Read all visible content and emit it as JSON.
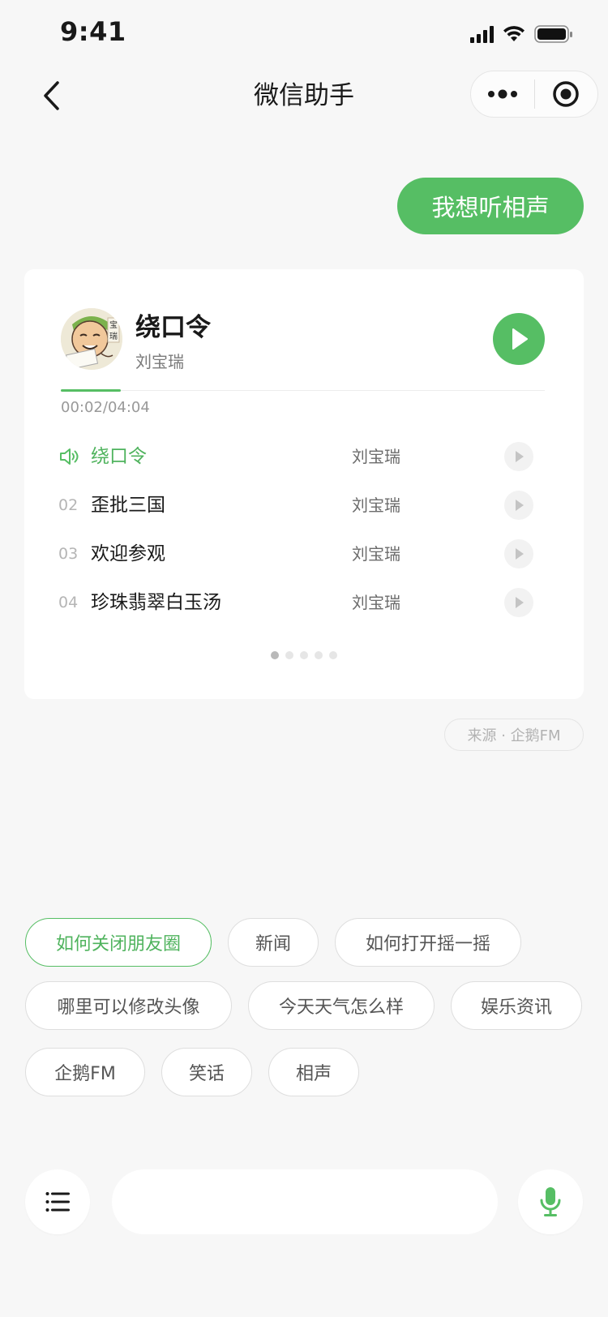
{
  "status_bar": {
    "time": "9:41"
  },
  "nav": {
    "title": "微信助手"
  },
  "chat": {
    "user_message": "我想听相声"
  },
  "player": {
    "current_title": "绕口令",
    "current_artist": "刘宝瑞",
    "time_display": "00:02/04:04",
    "progress_fraction": 0.008,
    "tracks": [
      {
        "number": "",
        "title": "绕口令",
        "artist": "刘宝瑞",
        "active": true
      },
      {
        "number": "02",
        "title": "歪批三国",
        "artist": "刘宝瑞",
        "active": false
      },
      {
        "number": "03",
        "title": "欢迎参观",
        "artist": "刘宝瑞",
        "active": false
      },
      {
        "number": "04",
        "title": "珍珠翡翠白玉汤",
        "artist": "刘宝瑞",
        "active": false
      }
    ],
    "page_count": 5,
    "current_page": 1
  },
  "source": {
    "label": "来源 · 企鹅FM"
  },
  "suggestions": [
    "如何关闭朋友圈",
    "新闻",
    "如何打开摇一摇",
    "哪里可以修改头像",
    "今天天气怎么样",
    "娱乐资讯",
    "企鹅FM",
    "笑话",
    "相声"
  ],
  "input": {
    "value": "",
    "placeholder": ""
  },
  "colors": {
    "accent": "#56be64",
    "accent_text": "#4fb35d",
    "background": "#f7f7f7",
    "card": "#ffffff"
  },
  "icons": {
    "back": "chevron-left-icon",
    "more": "more-dots-icon",
    "close_miniprogram": "target-circle-icon",
    "play": "play-icon",
    "speaker": "speaker-icon",
    "menu": "list-menu-icon",
    "mic": "microphone-icon"
  }
}
